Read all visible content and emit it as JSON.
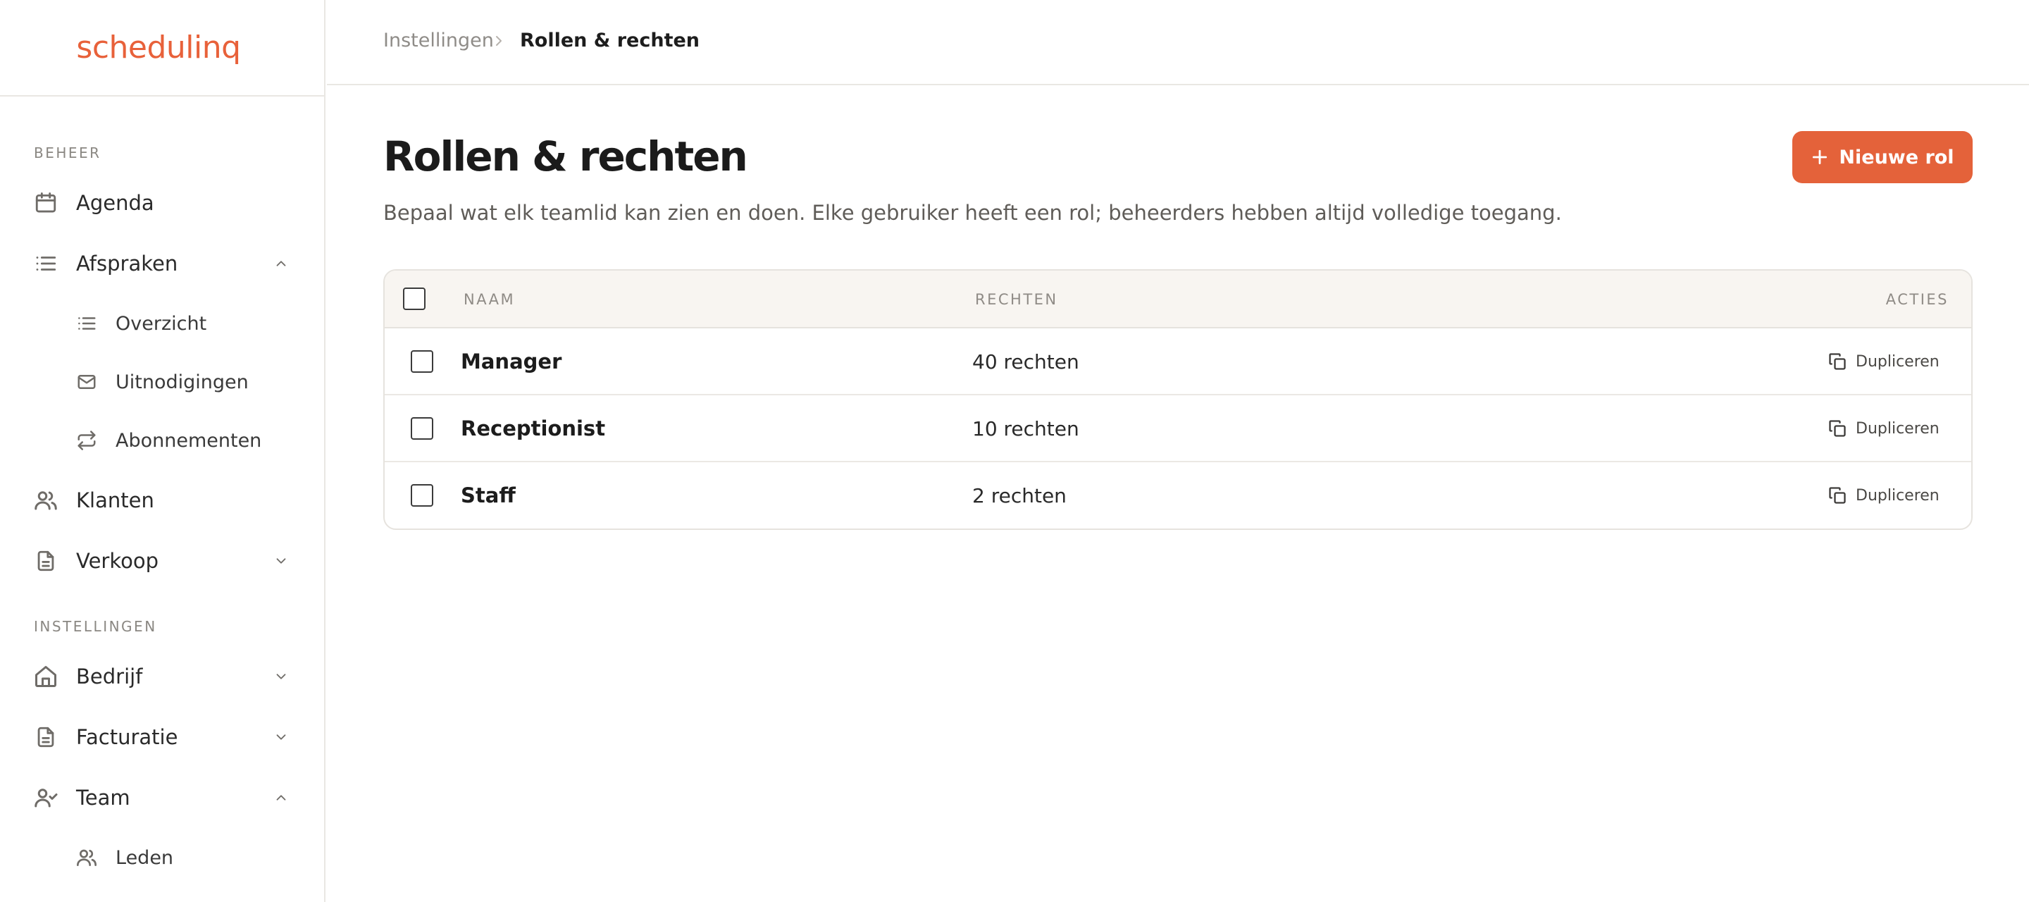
{
  "app": {
    "logo_text": "schedulinq",
    "accent": "#e4623a"
  },
  "sidebar": {
    "sections": [
      {
        "label": "BEHEER"
      },
      {
        "label": "INSTELLINGEN"
      }
    ],
    "items": [
      {
        "label": "Agenda",
        "icon": "calendar-icon"
      },
      {
        "label": "Afspraken",
        "icon": "list-icon",
        "expanded": true,
        "children": [
          {
            "label": "Overzicht",
            "icon": "list-icon"
          },
          {
            "label": "Uitnodigingen",
            "icon": "mail-icon"
          },
          {
            "label": "Abonnementen",
            "icon": "repeat-icon"
          }
        ]
      },
      {
        "label": "Klanten",
        "icon": "users-icon"
      },
      {
        "label": "Verkoop",
        "icon": "document-icon",
        "expanded": false
      },
      {
        "label": "Bedrijf",
        "icon": "home-icon",
        "expanded": false
      },
      {
        "label": "Facturatie",
        "icon": "document-icon",
        "expanded": false
      },
      {
        "label": "Team",
        "icon": "user-check-icon",
        "expanded": true,
        "children": [
          {
            "label": "Leden",
            "icon": "users-icon"
          }
        ]
      }
    ]
  },
  "breadcrumb": {
    "parent": "Instellingen",
    "current": "Rollen & rechten"
  },
  "page": {
    "title": "Rollen & rechten",
    "description": "Bepaal wat elk teamlid kan zien en doen. Elke gebruiker heeft een rol; beheerders hebben altijd volledige toegang.",
    "new_button": "Nieuwe rol"
  },
  "table": {
    "columns": [
      "NAAM",
      "RECHTEN",
      "ACTIES"
    ],
    "rows": [
      {
        "name": "Manager",
        "rights": "40 rechten",
        "action": "Dupliceren"
      },
      {
        "name": "Receptionist",
        "rights": "10 rechten",
        "action": "Dupliceren"
      },
      {
        "name": "Staff",
        "rights": "2 rechten",
        "action": "Dupliceren"
      }
    ]
  }
}
